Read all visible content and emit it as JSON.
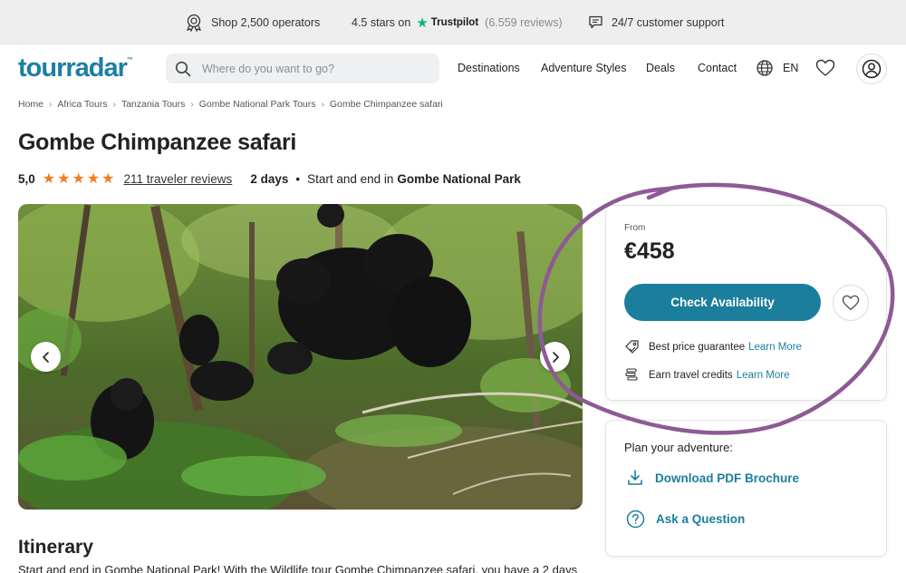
{
  "topbar": {
    "operators": "Shop 2,500 operators",
    "rating_text": "4.5 stars on",
    "trustpilot": "Trustpilot",
    "trustpilot_reviews": "(6.559 reviews)",
    "support": "24/7 customer support"
  },
  "header": {
    "logo": "tourradar",
    "logo_tm": "™",
    "search_placeholder": "Where do you want to go?",
    "nav": [
      "Destinations",
      "Adventure Styles",
      "Deals",
      "Contact"
    ],
    "language": "EN"
  },
  "breadcrumb": [
    "Home",
    "Africa Tours",
    "Tanzania Tours",
    "Gombe National Park Tours",
    "Gombe Chimpanzee safari"
  ],
  "tour": {
    "title": "Gombe Chimpanzee safari",
    "rating": "5,0",
    "star_count": 5,
    "reviews": "211 traveler reviews",
    "duration": "2 days",
    "start_end_prefix": "Start and end in",
    "start_end_place": "Gombe National Park"
  },
  "price_card": {
    "from_label": "From",
    "price": "€458",
    "cta": "Check Availability",
    "perk1": "Best price guarantee",
    "perk2": "Earn travel credits",
    "learn_more": "Learn More"
  },
  "plan_card": {
    "title": "Plan your adventure:",
    "brochure": "Download PDF Brochure",
    "question": "Ask a Question"
  },
  "itinerary": {
    "heading": "Itinerary",
    "intro": "Start and end in Gombe National Park! With the Wildlife tour Gombe Chimpanzee safari, you have a 2 days"
  },
  "colors": {
    "brand": "#1c7fa3",
    "cta": "#1b7e9c",
    "star": "#f07e23",
    "trustpilot": "#00b67a",
    "annotation": "#8e5a96"
  },
  "icons": {
    "operators": "award-icon",
    "trustpilot": "trustpilot-star-icon",
    "support": "chat-icon",
    "search": "search-icon",
    "language": "globe-icon",
    "wishlist": "heart-icon",
    "account": "user-icon",
    "price_guarantee": "price-tag-icon",
    "credits": "coins-icon",
    "download": "download-icon",
    "question": "question-icon",
    "prev": "chevron-left-icon",
    "next": "chevron-right-icon"
  }
}
